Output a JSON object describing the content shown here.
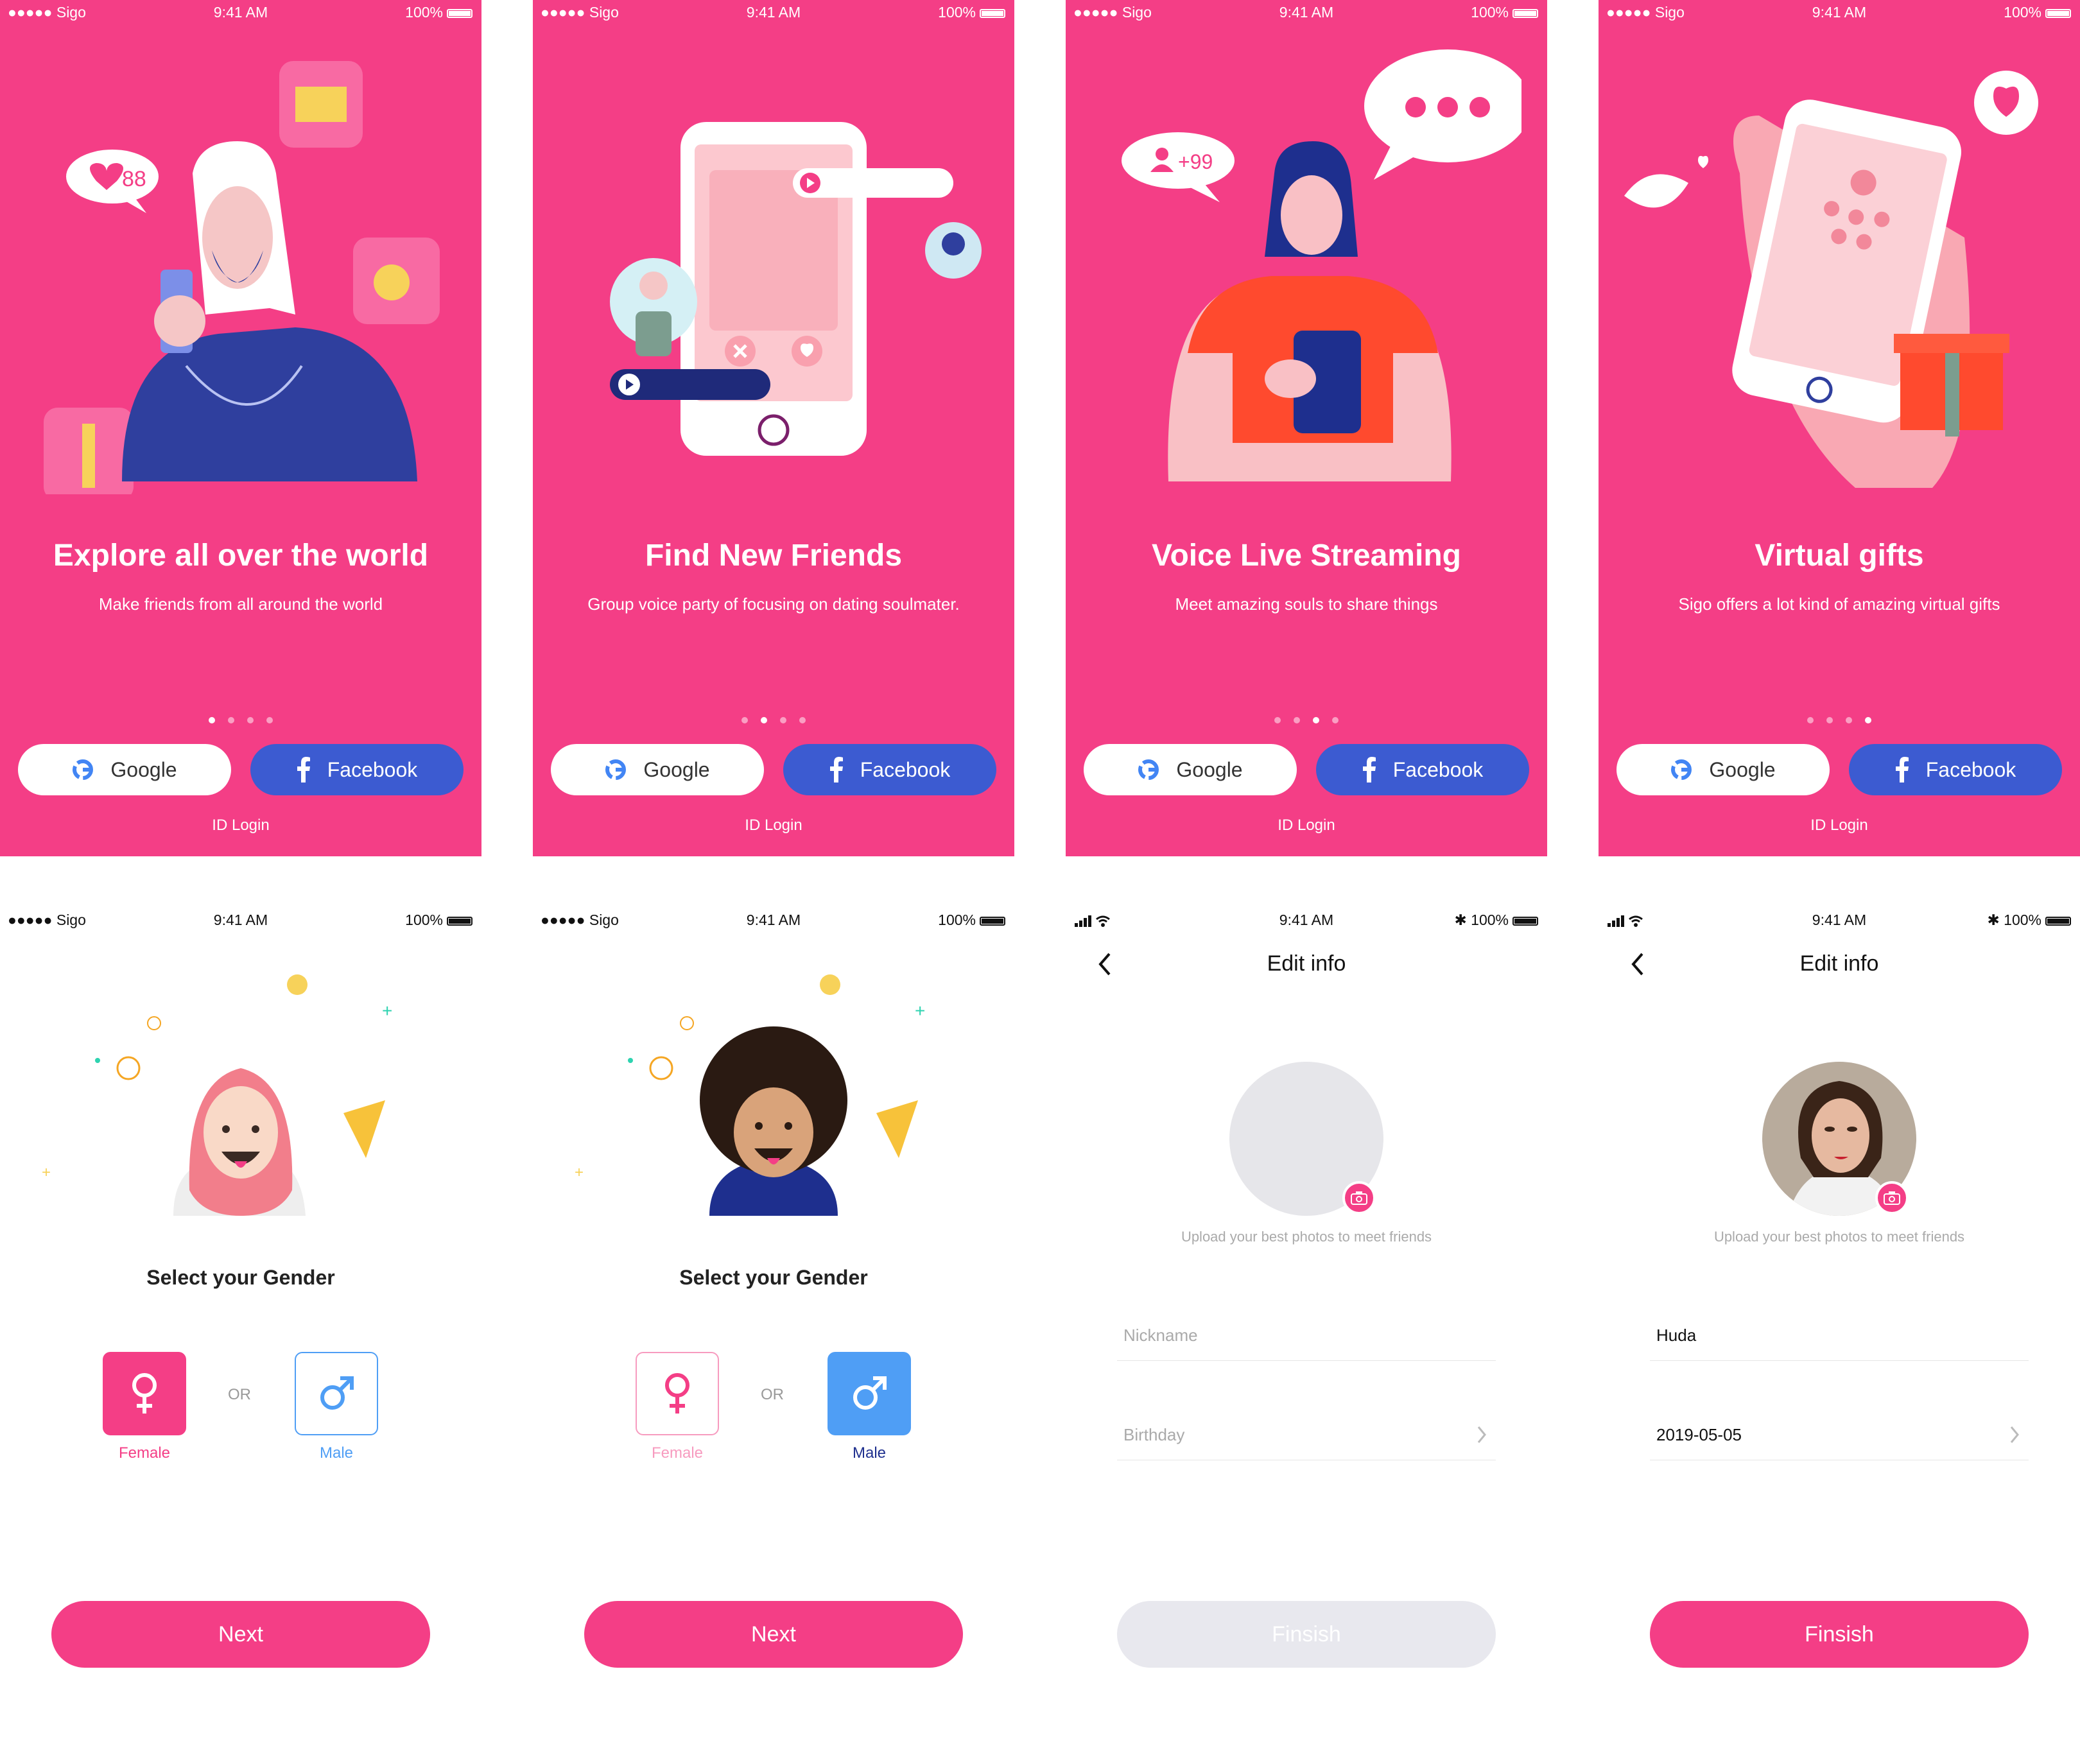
{
  "status": {
    "carrier": "●●●●● Sigo",
    "time": "9:41 AM",
    "battery": "100%"
  },
  "onboarding": [
    {
      "title": "Explore all over the world",
      "subtitle": "Make friends from all around the world",
      "likes": "88"
    },
    {
      "title": "Find New Friends",
      "subtitle": "Group voice party of focusing on dating soulmater."
    },
    {
      "title": "Voice Live Streaming",
      "subtitle": "Meet amazing souls to share things",
      "followers": "+99"
    },
    {
      "title": "Virtual gifts",
      "subtitle": "Sigo offers a lot kind of amazing virtual gifts"
    }
  ],
  "login": {
    "google": "Google",
    "facebook": "Facebook",
    "id_login": "ID Login"
  },
  "gender": {
    "title": "Select your Gender",
    "female": "Female",
    "male": "Male",
    "or": "OR",
    "next": "Next"
  },
  "edit_info": {
    "title": "Edit info",
    "upload_hint": "Upload your best photos to meet friends",
    "nickname_placeholder": "Nickname",
    "birthday_placeholder": "Birthday",
    "nickname_value": "Huda",
    "birthday_value": "2019-05-05",
    "finish": "Finsish"
  },
  "colors": {
    "brand": "#f43e86",
    "facebook": "#3c5bd1",
    "male": "#4f9ef5",
    "disabled": "#e8e8ee",
    "skin": "#f5c6c6"
  }
}
